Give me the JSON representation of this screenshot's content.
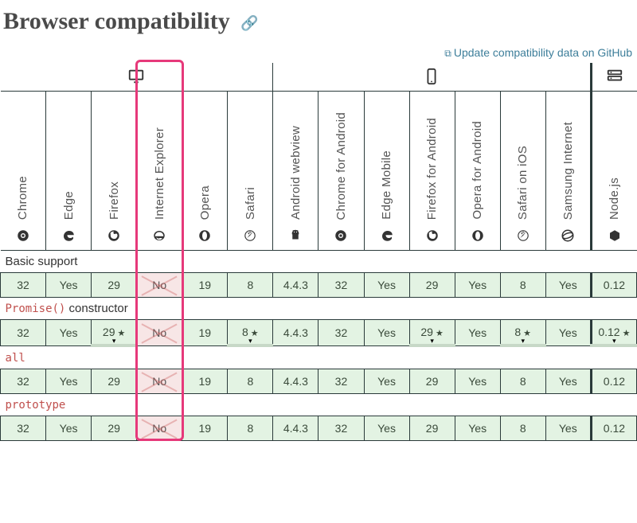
{
  "heading": "Browser compatibility",
  "update_link_text": "Update compatibility data on GitHub",
  "platforms": [
    {
      "id": "desktop",
      "span": 6
    },
    {
      "id": "mobile",
      "span": 7
    },
    {
      "id": "server",
      "span": 1
    }
  ],
  "browsers": [
    {
      "id": "chrome",
      "label": "Chrome"
    },
    {
      "id": "edge",
      "label": "Edge"
    },
    {
      "id": "firefox",
      "label": "Firefox"
    },
    {
      "id": "ie",
      "label": "Internet Explorer"
    },
    {
      "id": "opera",
      "label": "Opera"
    },
    {
      "id": "safari",
      "label": "Safari"
    },
    {
      "id": "android-webview",
      "label": "Android webview"
    },
    {
      "id": "chrome-android",
      "label": "Chrome for Android"
    },
    {
      "id": "edge-mobile",
      "label": "Edge Mobile"
    },
    {
      "id": "firefox-android",
      "label": "Firefox for Android"
    },
    {
      "id": "opera-android",
      "label": "Opera for Android"
    },
    {
      "id": "safari-ios",
      "label": "Safari on iOS"
    },
    {
      "id": "samsung",
      "label": "Samsung Internet"
    },
    {
      "id": "node",
      "label": "Node.js"
    }
  ],
  "features": [
    {
      "name_plain": "Basic support",
      "cells": [
        {
          "v": "32"
        },
        {
          "v": "Yes"
        },
        {
          "v": "29"
        },
        {
          "v": "No",
          "no": true
        },
        {
          "v": "19"
        },
        {
          "v": "8"
        },
        {
          "v": "4.4.3"
        },
        {
          "v": "32"
        },
        {
          "v": "Yes"
        },
        {
          "v": "29"
        },
        {
          "v": "Yes"
        },
        {
          "v": "8"
        },
        {
          "v": "Yes"
        },
        {
          "v": "0.12"
        }
      ]
    },
    {
      "name_code": "Promise()",
      "name_rest": " constructor",
      "cells": [
        {
          "v": "32"
        },
        {
          "v": "Yes"
        },
        {
          "v": "29",
          "note": true,
          "expand": true
        },
        {
          "v": "No",
          "no": true
        },
        {
          "v": "19"
        },
        {
          "v": "8",
          "note": true,
          "expand": true
        },
        {
          "v": "4.4.3"
        },
        {
          "v": "32"
        },
        {
          "v": "Yes"
        },
        {
          "v": "29",
          "note": true,
          "expand": true
        },
        {
          "v": "Yes"
        },
        {
          "v": "8",
          "note": true,
          "expand": true
        },
        {
          "v": "Yes"
        },
        {
          "v": "0.12",
          "note": true,
          "expand": true
        }
      ]
    },
    {
      "name_code": "all",
      "cells": [
        {
          "v": "32"
        },
        {
          "v": "Yes"
        },
        {
          "v": "29"
        },
        {
          "v": "No",
          "no": true
        },
        {
          "v": "19"
        },
        {
          "v": "8"
        },
        {
          "v": "4.4.3"
        },
        {
          "v": "32"
        },
        {
          "v": "Yes"
        },
        {
          "v": "29"
        },
        {
          "v": "Yes"
        },
        {
          "v": "8"
        },
        {
          "v": "Yes"
        },
        {
          "v": "0.12"
        }
      ]
    },
    {
      "name_code": "prototype",
      "cells": [
        {
          "v": "32"
        },
        {
          "v": "Yes"
        },
        {
          "v": "29"
        },
        {
          "v": "No",
          "no": true
        },
        {
          "v": "19"
        },
        {
          "v": "8"
        },
        {
          "v": "4.4.3"
        },
        {
          "v": "32"
        },
        {
          "v": "Yes"
        },
        {
          "v": "29"
        },
        {
          "v": "Yes"
        },
        {
          "v": "8"
        },
        {
          "v": "Yes"
        },
        {
          "v": "0.12"
        }
      ]
    }
  ],
  "highlight_column_index": 3
}
